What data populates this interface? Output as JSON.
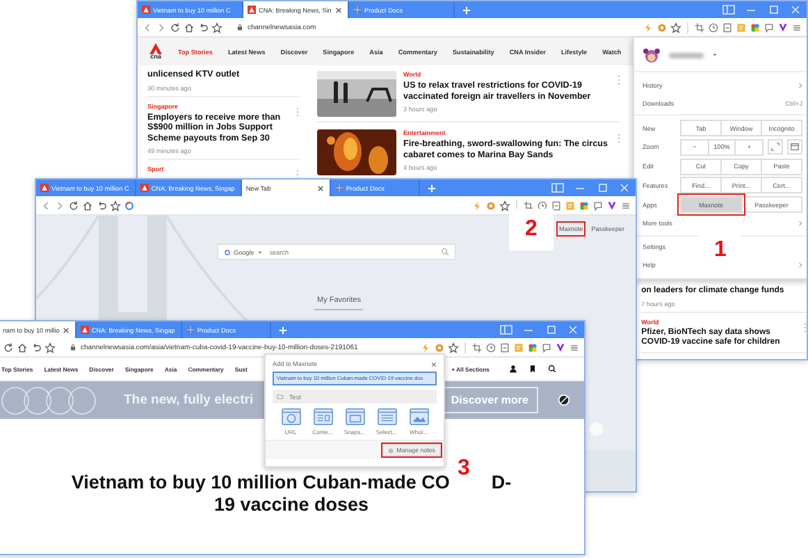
{
  "back_window": {
    "tabs": [
      {
        "title": "Vietnam to buy 10 million C",
        "selected": false
      },
      {
        "title": "CNA: Breaking News, Sin",
        "selected": true
      },
      {
        "title": "Product Docs",
        "selected": false
      }
    ],
    "url": "channelnewsasia.com",
    "logo": "cna",
    "nav": [
      {
        "label": "Top Stories",
        "selected": true
      },
      {
        "label": "Latest News",
        "selected": false
      },
      {
        "label": "Discover",
        "selected": false
      },
      {
        "label": "Singapore",
        "selected": false
      },
      {
        "label": "Asia",
        "selected": false
      },
      {
        "label": "Commentary",
        "selected": false
      },
      {
        "label": "Sustainability",
        "selected": false
      },
      {
        "label": "CNA Insider",
        "selected": false
      },
      {
        "label": "Lifestyle",
        "selected": false
      },
      {
        "label": "Watch",
        "selected": false
      }
    ],
    "columns": [
      {
        "kind": "text",
        "articles": [
          {
            "headline": "unlicensed KTV outlet",
            "time": "30 minutes ago"
          },
          {
            "category": "Singapore",
            "headline": "Employers to receive more than S$900 million in Jobs Support Scheme payouts from Sep 30",
            "time": "49 minutes ago"
          },
          {
            "category": "Sport"
          }
        ]
      },
      {
        "kind": "thumbnails",
        "articles": [
          {
            "category": "World",
            "headline": "US to relax travel restrictions for COVID-19 vaccinated foreign air travellers in November",
            "time": "3 hours ago"
          },
          {
            "category": "Entertainment",
            "headline": "Fire-breathing, sword-swallowing fun: The circus cabaret comes to Marina Bay Sands",
            "time": "4 hours ago"
          }
        ]
      },
      {
        "kind": "text",
        "articles": [
          {
            "headline": "on leaders for climate change funds",
            "time": "7 hours ago"
          },
          {
            "category": "World",
            "headline": "Pfizer, BioNTech say data shows COVID-19 vaccine safe for children"
          }
        ]
      }
    ],
    "menu": {
      "rows": [
        {
          "kind": "profile"
        },
        {
          "kind": "link",
          "label": "History",
          "arrow": true
        },
        {
          "kind": "link",
          "label": "Downloads",
          "shortcut": "Ctrl+J",
          "arrow": false
        },
        {
          "kind": "divider"
        },
        {
          "kind": "buttons",
          "label": "New",
          "buttons": [
            {
              "label": "Tab",
              "highlighted": false
            },
            {
              "label": "Window",
              "highlighted": false
            },
            {
              "label": "Incognito",
              "highlighted": false
            }
          ]
        },
        {
          "kind": "zoom",
          "label": "Zoom",
          "buttons": [
            {
              "label": "−",
              "highlighted": false
            },
            {
              "label": "100%",
              "highlighted": false
            },
            {
              "label": "+",
              "highlighted": false
            }
          ]
        },
        {
          "kind": "buttons",
          "label": "Edit",
          "buttons": [
            {
              "label": "Cut",
              "highlighted": false
            },
            {
              "label": "Copy",
              "highlighted": false
            },
            {
              "label": "Paste",
              "highlighted": false
            }
          ]
        },
        {
          "kind": "buttons",
          "label": "Features",
          "buttons": [
            {
              "label": "Find...",
              "highlighted": false
            },
            {
              "label": "Print...",
              "highlighted": false
            },
            {
              "label": "Cert...",
              "highlighted": false
            }
          ]
        },
        {
          "kind": "buttons",
          "label": "Apps",
          "buttons": [
            {
              "label": "Maxnote",
              "highlighted": true
            },
            {
              "label": "Passkeeper",
              "highlighted": false
            }
          ]
        },
        {
          "kind": "link",
          "label": "More tools",
          "arrow": true
        },
        {
          "kind": "divider"
        },
        {
          "kind": "link",
          "label": "Settings",
          "arrow": false
        },
        {
          "kind": "link",
          "label": "Help",
          "arrow": true
        }
      ]
    }
  },
  "middle_window": {
    "tabs": [
      {
        "title": "Vietnam to buy 10 million C",
        "selected": false
      },
      {
        "title": "CNA: Breaking News, Singap",
        "selected": false
      },
      {
        "title": "New Tab",
        "selected": true
      },
      {
        "title": "Product Docs",
        "selected": false
      }
    ],
    "search": {
      "engine": "Google",
      "placeholder": "search"
    },
    "apps": [
      {
        "label": "Maxnote",
        "highlighted": true
      },
      {
        "label": "Passkeeper",
        "highlighted": false
      }
    ],
    "favorites_title": "My Favorites"
  },
  "front_window": {
    "tabs": [
      {
        "title": "nam to buy 10 millio",
        "selected": true
      },
      {
        "title": "CNA: Breaking News, Singap",
        "selected": false
      },
      {
        "title": "Product Docs",
        "selected": false
      }
    ],
    "url": "channelnewsasia.com/asia/vietnam-cuba-covid-19-vaccine-buy-10-million-doses-2191061",
    "nav": [
      {
        "label": "Top Stories"
      },
      {
        "label": "Latest News"
      },
      {
        "label": "Discover"
      },
      {
        "label": "Singapore"
      },
      {
        "label": "Asia"
      },
      {
        "label": "Commentary"
      },
      {
        "label": "Sust"
      }
    ],
    "all_sections": "+ All Sections",
    "banner": {
      "text": "The new, fully electri",
      "button": "Discover more"
    },
    "headline": {
      "line1_start": "Vietnam to buy 10 million Cuban-made CO",
      "line1_end": "D-",
      "line2": "19 vaccine doses"
    },
    "popup": {
      "title": "Add to Maxnote",
      "title_value": "Vietnam to buy 10 million Cuban-made COVID-19 vaccine dos",
      "folder": "Test",
      "actions": [
        {
          "label": "URL"
        },
        {
          "label": "Conte..."
        },
        {
          "label": "Snaps..."
        },
        {
          "label": "Select..."
        },
        {
          "label": "Whol..."
        }
      ],
      "manage": {
        "label": "Manage notes",
        "highlighted": true
      }
    }
  },
  "markers": [
    "1",
    "2",
    "3"
  ]
}
